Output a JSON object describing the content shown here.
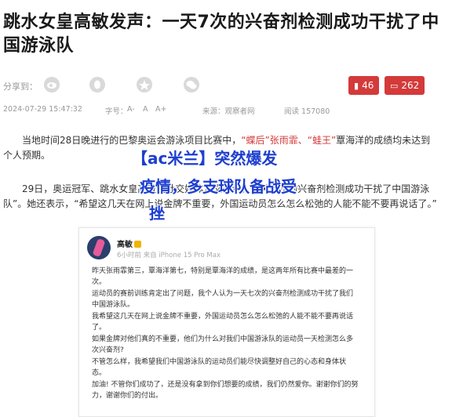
{
  "article": {
    "title": "跳水女皇高敏发声：一天7次的兴奋剂检测成功干扰了中国游泳队",
    "share_label": "分享到：",
    "favorite_count": "46",
    "comment_count": "262",
    "date": "2024-07-29 15:47:32",
    "font_size_label": "字号：",
    "font_a_minus": "A-",
    "font_a": "A",
    "font_a_plus": "A+",
    "source": "来源：观察者网",
    "views": "阅读 157080",
    "p1_a": "当地时间28日晚进行的巴黎奥运会游泳项目比赛中，",
    "p1_red1": "“蝶后”",
    "p1_b": "张雨霏、",
    "p1_red2": "“蛙王”",
    "p1_c": "覃海洋的成绩均未达到个人预期。",
    "p2": "29日，奥运冠军、跳水女皇高敏在社交媒体发文表示，一天七次的兴奋剂检测成功干扰了中国游泳队”。她还表示，“希望这几天在网上说金牌不重要，外国运动员怎么怎么松弛的人能不能不要再说话了。”"
  },
  "overlay": {
    "line1": "【ac米兰】突然爆发",
    "line2": "疫情，多支球队备战受",
    "line3": "挫"
  },
  "post": {
    "user_name": "高敏",
    "meta": "6小时前  来自 iPhone 15 Pro Max",
    "lines": [
      "昨天张雨霏第三，覃海洋第七，特别是覃海洋的成绩，是这两年所有比赛中最差的一次。",
      "运动员的赛前训练肯定出了问题，我个人认为一天七次的兴奋剂检测成功干扰了我们中国游泳队。",
      "我希望这几天在网上说金牌不重要，外国运动员怎么怎么松弛的人能不能不要再说话了。",
      "如果金牌对他们真的不重要，他们为什么对我们中国游泳队的运动员一天检测怎么多次兴奋剂?",
      "不管怎么样，我希望我们中国游泳队的运动员们能尽快调整好自己的心态和身体状态。",
      "加油! 不管你们成功了，还是没有拿到你们想要的成绩，我们仍然爱你。谢谢你们的努力，谢谢你们的付出。"
    ]
  },
  "colors": {
    "accent": "#d43a3a",
    "overlay": "#1e3fcf"
  }
}
